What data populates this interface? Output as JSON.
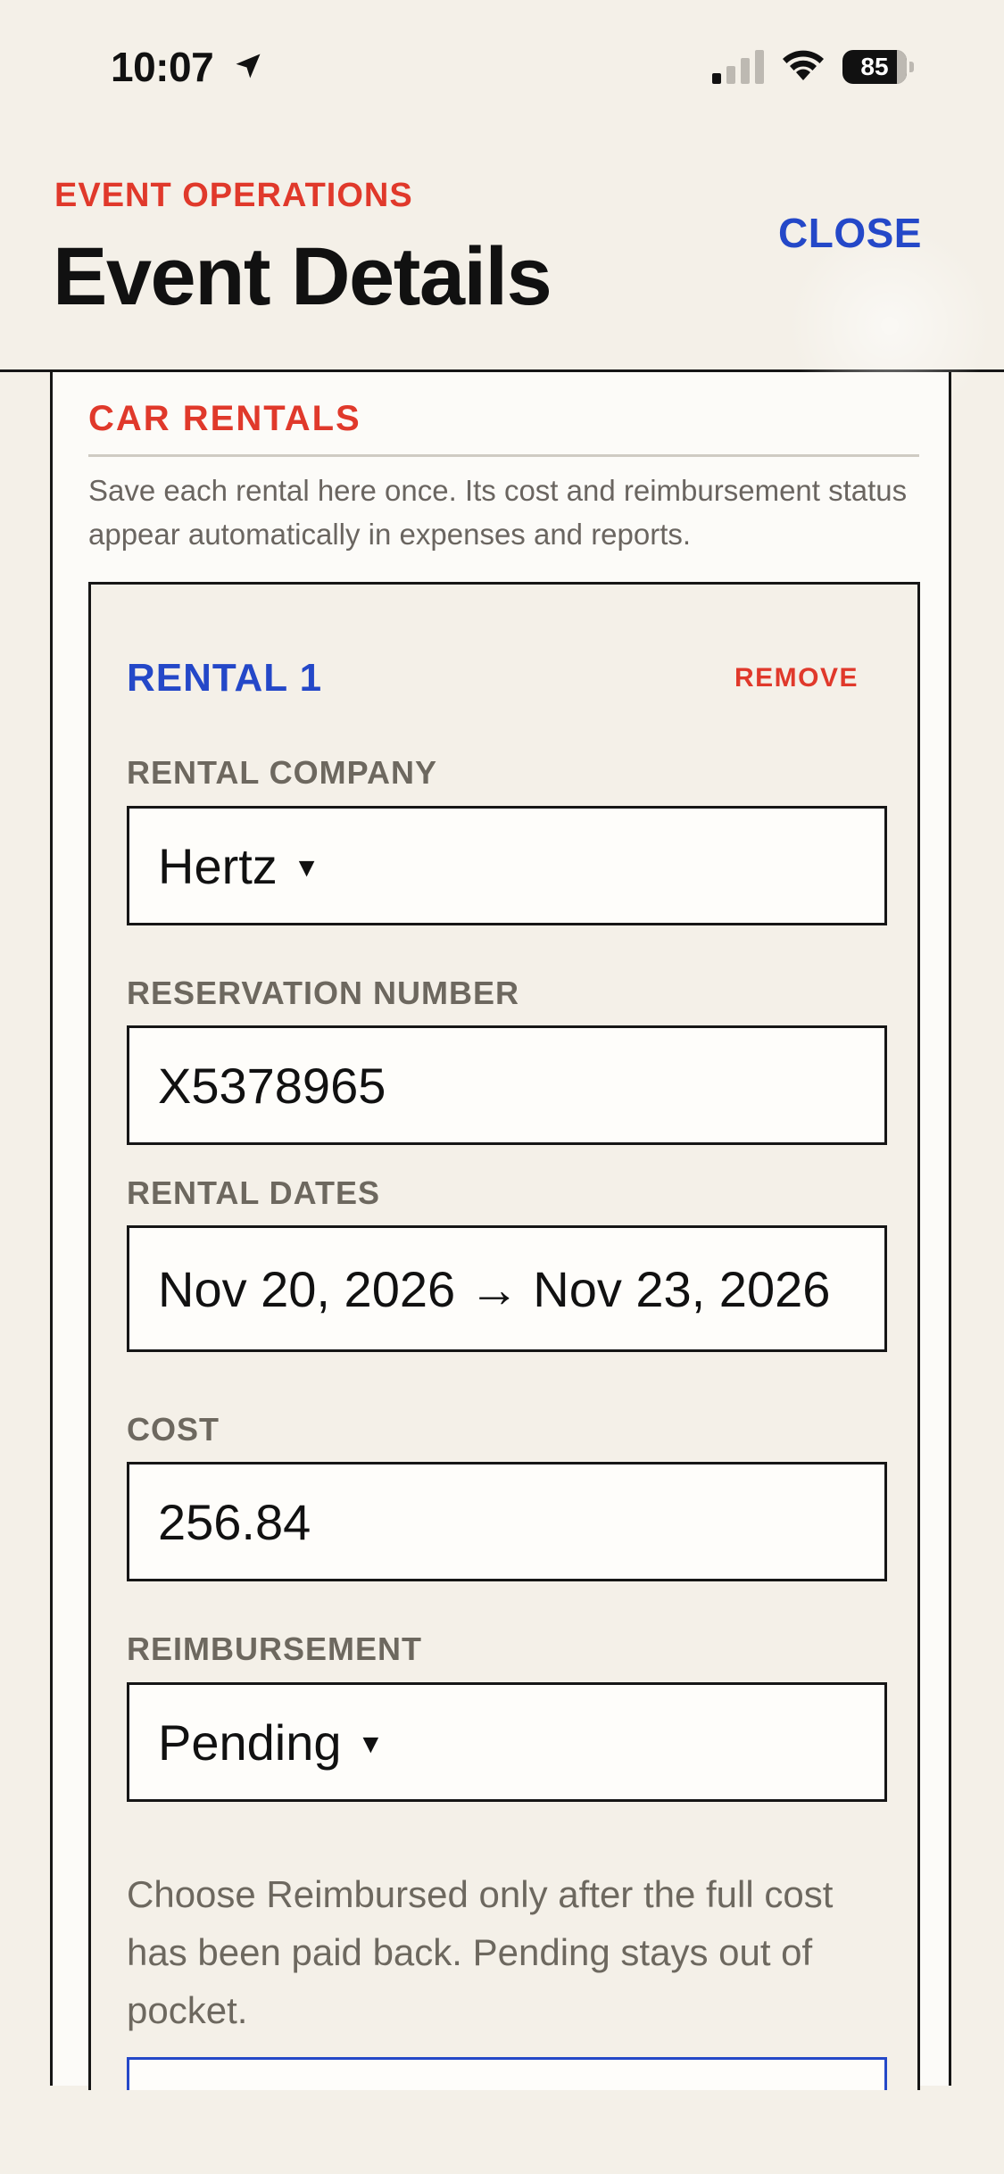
{
  "status_bar": {
    "time": "10:07",
    "battery_level": "85",
    "battery_fraction": 0.85
  },
  "header": {
    "kicker": "EVENT OPERATIONS",
    "title": "Event Details",
    "close_label": "CLOSE"
  },
  "section": {
    "title": "CAR RENTALS",
    "description": "Save each rental here once. Its cost and reimbursement status appear automatically in expenses and reports."
  },
  "rental": {
    "title": "RENTAL 1",
    "remove_label": "REMOVE",
    "company_label": "RENTAL COMPANY",
    "company_value": "Hertz",
    "reservation_label": "RESERVATION NUMBER",
    "reservation_value": "X5378965",
    "dates_label": "RENTAL DATES",
    "dates_value": "Nov 20, 2026 → Nov 23, 2026",
    "cost_label": "COST",
    "cost_value": "256.84",
    "reimbursement_label": "REIMBURSEMENT",
    "reimbursement_value": "Pending",
    "help_text": "Choose Reimbursed only after the full cost has been paid back. Pending stays out of pocket."
  },
  "icons": {
    "location": "location-arrow-icon",
    "signal": "cellular-signal-icon",
    "wifi": "wifi-icon",
    "battery": "battery-icon",
    "dropdown_caret": "caret-down-icon"
  },
  "colors": {
    "accent_red": "#e0392b",
    "accent_blue": "#2448c8",
    "background": "#f4f0e8",
    "label_gray": "#6d685f"
  }
}
